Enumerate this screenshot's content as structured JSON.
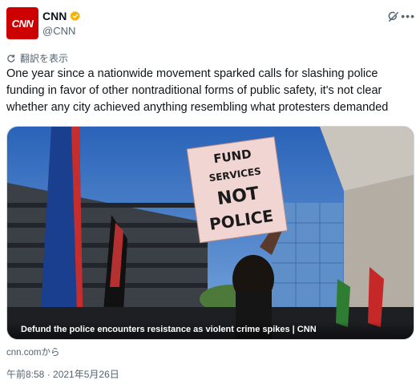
{
  "author": {
    "avatar_text": "CNN",
    "name": "CNN",
    "handle": "@CNN"
  },
  "translate_label": "翻訳を表示",
  "tweet_text": "One year since a nationwide movement sparked calls for slashing police funding in favor of other nontraditional forms of public safety, it's not clear whether any city achieved anything resembling what protesters demanded",
  "media": {
    "sign_lines": [
      "FUND",
      "SERVICES",
      "NOT",
      "POLICE"
    ],
    "caption": "Defund the police encounters resistance as violent crime spikes | CNN"
  },
  "source": "cnn.comから",
  "timestamp": "午前8:58 · 2021年5月26日",
  "colors": {
    "brand": "#cc0000",
    "verified": "#f4b400",
    "muted": "#536471"
  }
}
